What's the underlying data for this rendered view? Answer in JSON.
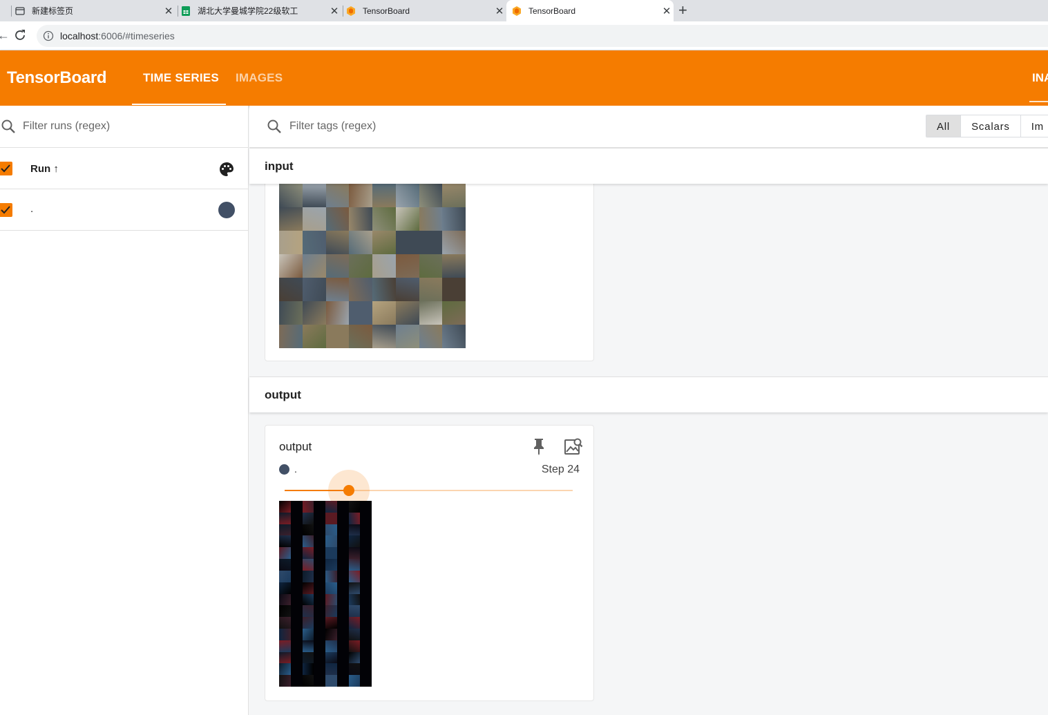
{
  "browser": {
    "tabs": [
      {
        "title": "新建标签页",
        "icon": "page-icon"
      },
      {
        "title": "湖北大学曼城学院22级软工",
        "icon": "sheets-icon"
      },
      {
        "title": "TensorBoard",
        "icon": "tensorboard-icon"
      },
      {
        "title": "TensorBoard",
        "icon": "tensorboard-icon"
      }
    ],
    "close_glyph": "✕",
    "new_tab_glyph": "+",
    "url_host": "localhost",
    "url_rest": ":6006/#timeseries"
  },
  "header": {
    "brand": "TensorBoard",
    "tabs": [
      {
        "label": "TIME SERIES",
        "active": true
      },
      {
        "label": "IMAGES",
        "active": false
      }
    ],
    "right_tab": "INA",
    "accent_color": "#f57c00"
  },
  "sidebar": {
    "filter_placeholder": "Filter runs (regex)",
    "run_header": "Run",
    "sort_glyph": "↑",
    "runs": [
      {
        "name": ".",
        "color": "#425066",
        "checked": true
      }
    ]
  },
  "main": {
    "tag_filter_placeholder": "Filter tags (regex)",
    "type_filters": [
      {
        "label": "All",
        "selected": true
      },
      {
        "label": "Scalars",
        "selected": false
      },
      {
        "label": "Im",
        "selected": false
      }
    ],
    "groups": [
      {
        "name": "input"
      },
      {
        "name": "output"
      }
    ],
    "output_card": {
      "title": "output",
      "run_name": ".",
      "step_label": "Step 24",
      "slider_position_fraction": 0.22
    }
  }
}
